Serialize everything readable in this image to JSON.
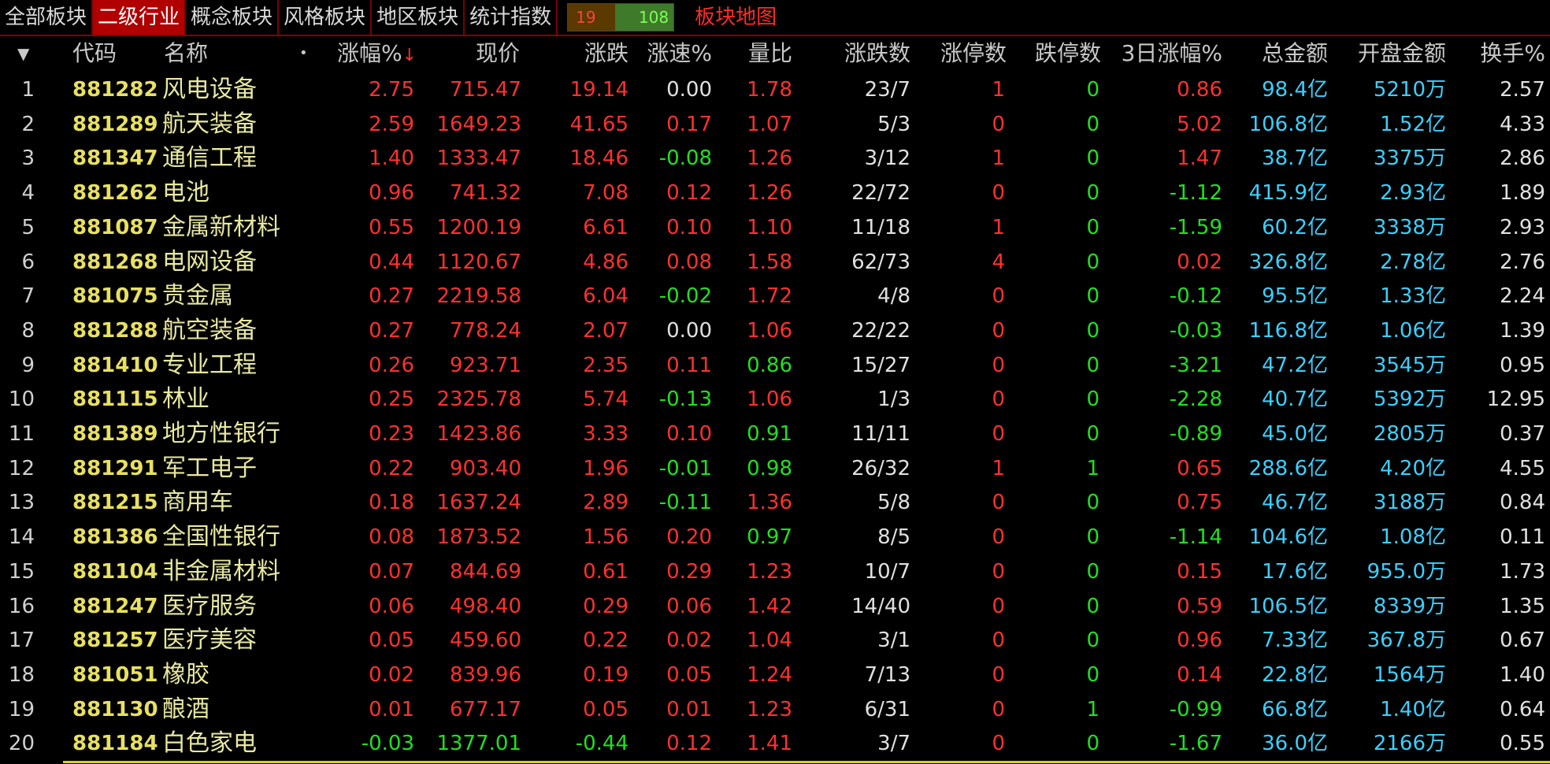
{
  "tabs": [
    {
      "label": "全部板块",
      "active": false
    },
    {
      "label": "二级行业",
      "active": true
    },
    {
      "label": "概念板块",
      "active": false
    },
    {
      "label": "风格板块",
      "active": false
    },
    {
      "label": "地区板块",
      "active": false
    },
    {
      "label": "统计指数",
      "active": false
    }
  ],
  "stats": {
    "up": "19",
    "down": "108"
  },
  "map_link": "板块地图",
  "columns": {
    "menu": "▼",
    "code": "代码",
    "name": "名称",
    "dot": "•",
    "pct": "涨幅%",
    "sort_arrow": "↓",
    "price": "现价",
    "change": "涨跌",
    "speed": "涨速%",
    "vol_ratio": "量比",
    "updown": "涨跌数",
    "limit_up": "涨停数",
    "limit_down": "跌停数",
    "pct3d": "3日涨幅%",
    "amount": "总金额",
    "open_amount": "开盘金额",
    "turnover": "换手%"
  },
  "rows": [
    {
      "i": "1",
      "code": "881282",
      "name": "风电设备",
      "pct": "2.75",
      "price": "715.47",
      "chg": "19.14",
      "speed": "0.00",
      "vr": "1.78",
      "ud": "23/7",
      "lu": "1",
      "ld": "0",
      "p3": "0.86",
      "amt": "98.4亿",
      "oamt": "5210万",
      "to": "2.57"
    },
    {
      "i": "2",
      "code": "881289",
      "name": "航天装备",
      "pct": "2.59",
      "price": "1649.23",
      "chg": "41.65",
      "speed": "0.17",
      "vr": "1.07",
      "ud": "5/3",
      "lu": "0",
      "ld": "0",
      "p3": "5.02",
      "amt": "106.8亿",
      "oamt": "1.52亿",
      "to": "4.33"
    },
    {
      "i": "3",
      "code": "881347",
      "name": "通信工程",
      "pct": "1.40",
      "price": "1333.47",
      "chg": "18.46",
      "speed": "-0.08",
      "vr": "1.26",
      "ud": "3/12",
      "lu": "1",
      "ld": "0",
      "p3": "1.47",
      "amt": "38.7亿",
      "oamt": "3375万",
      "to": "2.86"
    },
    {
      "i": "4",
      "code": "881262",
      "name": "电池",
      "pct": "0.96",
      "price": "741.32",
      "chg": "7.08",
      "speed": "0.12",
      "vr": "1.26",
      "ud": "22/72",
      "lu": "0",
      "ld": "0",
      "p3": "-1.12",
      "amt": "415.9亿",
      "oamt": "2.93亿",
      "to": "1.89"
    },
    {
      "i": "5",
      "code": "881087",
      "name": "金属新材料",
      "pct": "0.55",
      "price": "1200.19",
      "chg": "6.61",
      "speed": "0.10",
      "vr": "1.10",
      "ud": "11/18",
      "lu": "1",
      "ld": "0",
      "p3": "-1.59",
      "amt": "60.2亿",
      "oamt": "3338万",
      "to": "2.93"
    },
    {
      "i": "6",
      "code": "881268",
      "name": "电网设备",
      "pct": "0.44",
      "price": "1120.67",
      "chg": "4.86",
      "speed": "0.08",
      "vr": "1.58",
      "ud": "62/73",
      "lu": "4",
      "ld": "0",
      "p3": "0.02",
      "amt": "326.8亿",
      "oamt": "2.78亿",
      "to": "2.76"
    },
    {
      "i": "7",
      "code": "881075",
      "name": "贵金属",
      "pct": "0.27",
      "price": "2219.58",
      "chg": "6.04",
      "speed": "-0.02",
      "vr": "1.72",
      "ud": "4/8",
      "lu": "0",
      "ld": "0",
      "p3": "-0.12",
      "amt": "95.5亿",
      "oamt": "1.33亿",
      "to": "2.24"
    },
    {
      "i": "8",
      "code": "881288",
      "name": "航空装备",
      "pct": "0.27",
      "price": "778.24",
      "chg": "2.07",
      "speed": "0.00",
      "vr": "1.06",
      "ud": "22/22",
      "lu": "0",
      "ld": "0",
      "p3": "-0.03",
      "amt": "116.8亿",
      "oamt": "1.06亿",
      "to": "1.39"
    },
    {
      "i": "9",
      "code": "881410",
      "name": "专业工程",
      "pct": "0.26",
      "price": "923.71",
      "chg": "2.35",
      "speed": "0.11",
      "vr": "0.86",
      "ud": "15/27",
      "lu": "0",
      "ld": "0",
      "p3": "-3.21",
      "amt": "47.2亿",
      "oamt": "3545万",
      "to": "0.95"
    },
    {
      "i": "10",
      "code": "881115",
      "name": "林业",
      "pct": "0.25",
      "price": "2325.78",
      "chg": "5.74",
      "speed": "-0.13",
      "vr": "1.06",
      "ud": "1/3",
      "lu": "0",
      "ld": "0",
      "p3": "-2.28",
      "amt": "40.7亿",
      "oamt": "5392万",
      "to": "12.95"
    },
    {
      "i": "11",
      "code": "881389",
      "name": "地方性银行",
      "pct": "0.23",
      "price": "1423.86",
      "chg": "3.33",
      "speed": "0.10",
      "vr": "0.91",
      "ud": "11/11",
      "lu": "0",
      "ld": "0",
      "p3": "-0.89",
      "amt": "45.0亿",
      "oamt": "2805万",
      "to": "0.37"
    },
    {
      "i": "12",
      "code": "881291",
      "name": "军工电子",
      "pct": "0.22",
      "price": "903.40",
      "chg": "1.96",
      "speed": "-0.01",
      "vr": "0.98",
      "ud": "26/32",
      "lu": "1",
      "ld": "1",
      "p3": "0.65",
      "amt": "288.6亿",
      "oamt": "4.20亿",
      "to": "4.55"
    },
    {
      "i": "13",
      "code": "881215",
      "name": "商用车",
      "pct": "0.18",
      "price": "1637.24",
      "chg": "2.89",
      "speed": "-0.11",
      "vr": "1.36",
      "ud": "5/8",
      "lu": "0",
      "ld": "0",
      "p3": "0.75",
      "amt": "46.7亿",
      "oamt": "3188万",
      "to": "0.84"
    },
    {
      "i": "14",
      "code": "881386",
      "name": "全国性银行",
      "pct": "0.08",
      "price": "1873.52",
      "chg": "1.56",
      "speed": "0.20",
      "vr": "0.97",
      "ud": "8/5",
      "lu": "0",
      "ld": "0",
      "p3": "-1.14",
      "amt": "104.6亿",
      "oamt": "1.08亿",
      "to": "0.11"
    },
    {
      "i": "15",
      "code": "881104",
      "name": "非金属材料",
      "pct": "0.07",
      "price": "844.69",
      "chg": "0.61",
      "speed": "0.29",
      "vr": "1.23",
      "ud": "10/7",
      "lu": "0",
      "ld": "0",
      "p3": "0.15",
      "amt": "17.6亿",
      "oamt": "955.0万",
      "to": "1.73"
    },
    {
      "i": "16",
      "code": "881247",
      "name": "医疗服务",
      "pct": "0.06",
      "price": "498.40",
      "chg": "0.29",
      "speed": "0.06",
      "vr": "1.42",
      "ud": "14/40",
      "lu": "0",
      "ld": "0",
      "p3": "0.59",
      "amt": "106.5亿",
      "oamt": "8339万",
      "to": "1.35"
    },
    {
      "i": "17",
      "code": "881257",
      "name": "医疗美容",
      "pct": "0.05",
      "price": "459.60",
      "chg": "0.22",
      "speed": "0.02",
      "vr": "1.04",
      "ud": "3/1",
      "lu": "0",
      "ld": "0",
      "p3": "0.96",
      "amt": "7.33亿",
      "oamt": "367.8万",
      "to": "0.67"
    },
    {
      "i": "18",
      "code": "881051",
      "name": "橡胶",
      "pct": "0.02",
      "price": "839.96",
      "chg": "0.19",
      "speed": "0.05",
      "vr": "1.24",
      "ud": "7/13",
      "lu": "0",
      "ld": "0",
      "p3": "0.14",
      "amt": "22.8亿",
      "oamt": "1564万",
      "to": "1.40"
    },
    {
      "i": "19",
      "code": "881130",
      "name": "酿酒",
      "pct": "0.01",
      "price": "677.17",
      "chg": "0.05",
      "speed": "0.01",
      "vr": "1.23",
      "ud": "6/31",
      "lu": "0",
      "ld": "1",
      "p3": "-0.99",
      "amt": "66.8亿",
      "oamt": "1.40亿",
      "to": "0.64"
    },
    {
      "i": "20",
      "code": "881184",
      "name": "白色家电",
      "pct": "-0.03",
      "price": "1377.01",
      "chg": "-0.44",
      "speed": "0.12",
      "vr": "1.41",
      "ud": "3/7",
      "lu": "0",
      "ld": "0",
      "p3": "-1.67",
      "amt": "36.0亿",
      "oamt": "2166万",
      "to": "0.55"
    }
  ]
}
